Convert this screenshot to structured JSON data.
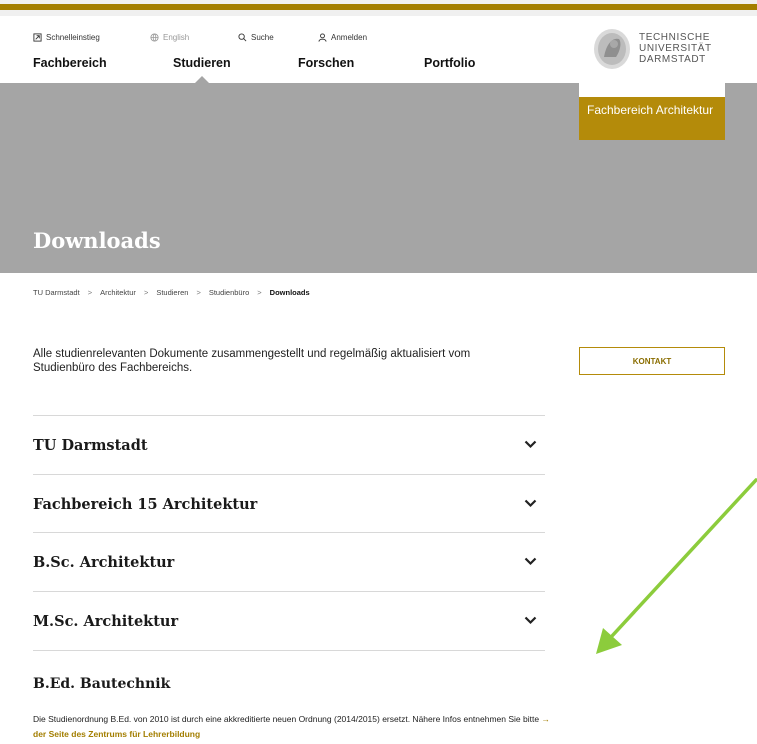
{
  "utility": {
    "quicklinks": "Schnelleinstieg",
    "english": "English",
    "search": "Suche",
    "login": "Anmelden"
  },
  "nav": {
    "items": [
      {
        "label": "Fachbereich"
      },
      {
        "label": "Studieren"
      },
      {
        "label": "Forschen"
      },
      {
        "label": "Portfolio"
      }
    ]
  },
  "logo": {
    "line1": "TECHNISCHE",
    "line2": "UNIVERSITÄT",
    "line3": "DARMSTADT",
    "department": "Fachbereich Architektur"
  },
  "page": {
    "title": "Downloads",
    "intro": "Alle studienrelevanten Dokumente zusammengestellt und regelmäßig aktualisiert vom Studienbüro des Fachbereichs.",
    "contact_button": "KONTAKT"
  },
  "breadcrumb": {
    "items": [
      "TU Darmstadt",
      "Architektur",
      "Studieren",
      "Studienbüro",
      "Downloads"
    ],
    "separator": ">"
  },
  "accordion": [
    {
      "title": "TU Darmstadt"
    },
    {
      "title": "Fachbereich 15 Architektur"
    },
    {
      "title": "B.Sc. Architektur"
    },
    {
      "title": "M.Sc. Architektur"
    }
  ],
  "bed": {
    "title": "B.Ed. Bautechnik",
    "text": "Die Studienordnung B.Ed. von 2010 ist durch eine akkreditierte neuen Ordnung (2014/2015) ersetzt. Nähere Infos entnehmen Sie bitte",
    "link": "→ der Seite des Zentrums für Lehrerbildung"
  },
  "colors": {
    "accent": "#a37e00",
    "department_box": "#b48b0a",
    "hero": "#a5a5a5",
    "annotation_arrow": "#8ccc3c"
  }
}
